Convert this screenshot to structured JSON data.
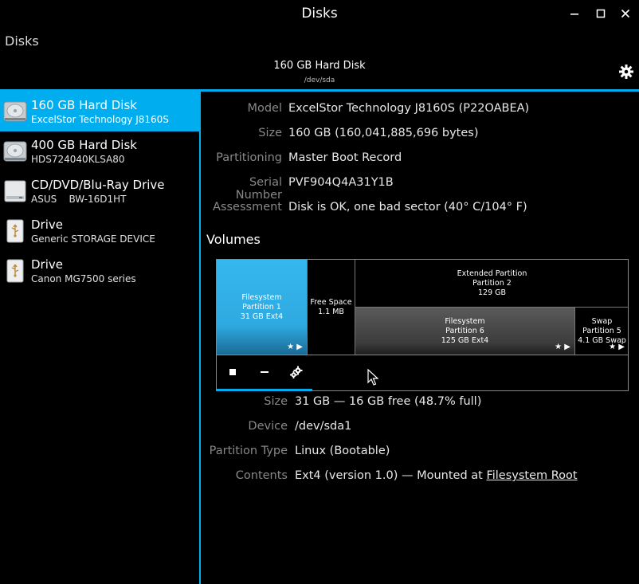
{
  "window": {
    "title": "Disks",
    "minimize_glyph": "—",
    "maximize_glyph": "□",
    "close_glyph": "✕"
  },
  "header": {
    "app_label": "Disks",
    "disk_title": "160 GB Hard Disk",
    "disk_path": "/dev/sda"
  },
  "sidebar": {
    "items": [
      {
        "name": "160 GB Hard Disk",
        "sub": "ExcelStor Technology J8160S",
        "icon": "hard-disk-icon",
        "selected": true
      },
      {
        "name": "400 GB Hard Disk",
        "sub": "HDS724040KLSA80",
        "icon": "hard-disk-icon",
        "selected": false
      },
      {
        "name": "CD/DVD/Blu-Ray Drive",
        "sub": "ASUS    BW-16D1HT",
        "icon": "optical-drive-icon",
        "selected": false
      },
      {
        "name": "Drive",
        "sub": "Generic STORAGE DEVICE",
        "icon": "usb-drive-icon",
        "selected": false
      },
      {
        "name": "Drive",
        "sub": "Canon MG7500 series",
        "icon": "usb-drive-icon",
        "selected": false
      }
    ]
  },
  "disk_props": {
    "model_label": "Model",
    "model_value": "ExcelStor Technology J8160S (P22OABEA)",
    "size_label": "Size",
    "size_value": "160 GB (160,041,885,696 bytes)",
    "partitioning_label": "Partitioning",
    "partitioning_value": "Master Boot Record",
    "serial_label": "Serial Number",
    "serial_value": "PVF904Q4A31Y1B",
    "assessment_label": "Assessment",
    "assessment_value": "Disk is OK, one bad sector (40° C/104° F)"
  },
  "volumes": {
    "heading": "Volumes",
    "p1": {
      "line1": "Filesystem",
      "line2": "Partition 1",
      "line3": "31 GB Ext4"
    },
    "free": {
      "line1": "Free Space",
      "line2": "1.1 MB"
    },
    "extended": {
      "line1": "Extended Partition",
      "line2": "Partition 2",
      "line3": "129 GB"
    },
    "p6": {
      "line1": "Filesystem",
      "line2": "Partition 6",
      "line3": "125 GB Ext4"
    },
    "p5": {
      "line1": "Swap",
      "line2": "Partition 5",
      "line3": "4.1 GB Swap"
    },
    "marks": "★ ▶"
  },
  "volume_props": {
    "size_label": "Size",
    "size_value": "31 GB — 16 GB free (48.7% full)",
    "device_label": "Device",
    "device_value": "/dev/sda1",
    "ptype_label": "Partition Type",
    "ptype_value": "Linux (Bootable)",
    "contents_label": "Contents",
    "contents_prefix": "Ext4 (version 1.0) — Mounted at ",
    "contents_link": "Filesystem Root"
  },
  "colors": {
    "accent": "#00aeef",
    "background": "#000000"
  }
}
